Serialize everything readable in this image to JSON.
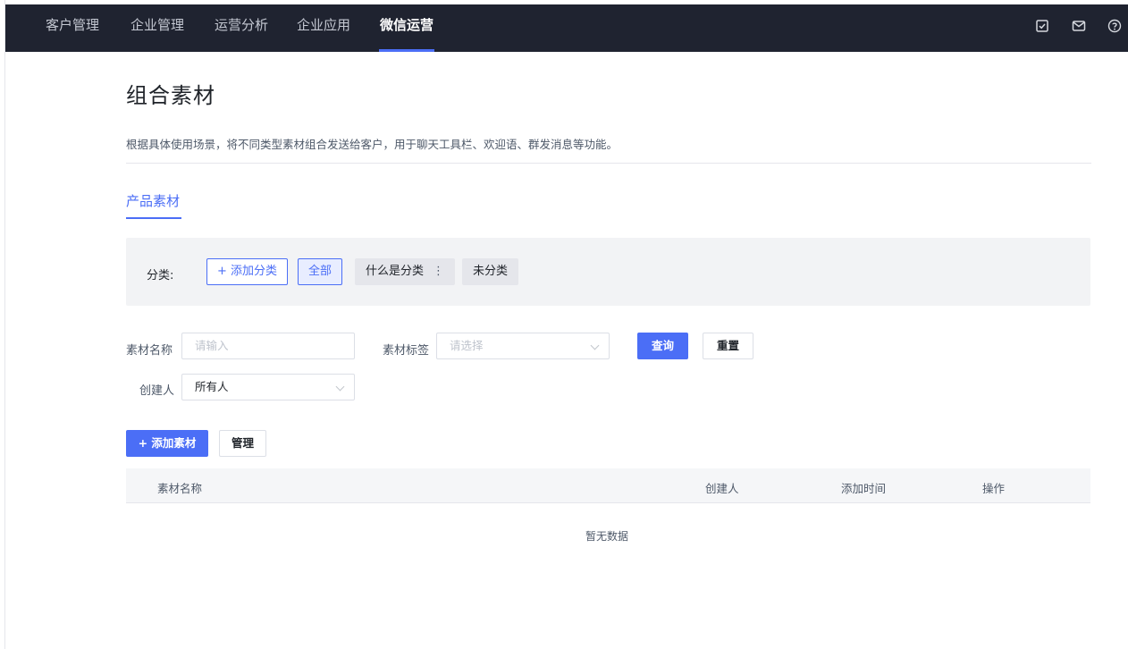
{
  "nav": {
    "items": [
      "客户管理",
      "企业管理",
      "运营分析",
      "企业应用",
      "微信运营"
    ],
    "active_index": 4,
    "icons": [
      "task-check-icon",
      "mail-icon",
      "help-icon"
    ]
  },
  "page": {
    "title": "组合素材",
    "description": "根据具体使用场景，将不同类型素材组合发送给客户，用于聊天工具栏、欢迎语、群发消息等功能。"
  },
  "tabs": [
    "产品素材"
  ],
  "category": {
    "label": "分类:",
    "add_label": "+ 添加分类",
    "items": [
      "全部",
      "什么是分类",
      "未分类"
    ],
    "selected": "全部",
    "more_glyph": "⋮"
  },
  "filters": {
    "name_label": "素材名称",
    "name_placeholder": "请输入",
    "tag_label": "素材标签",
    "tag_placeholder": "请选择",
    "creator_label": "创建人",
    "creator_value": "所有人",
    "query_label": "查询",
    "reset_label": "重置"
  },
  "actions": {
    "add_material_label": "+ 添加素材",
    "manage_label": "管理"
  },
  "table": {
    "columns": [
      "素材名称",
      "创建人",
      "添加时间",
      "操作"
    ],
    "rows": [],
    "empty_text": "暂无数据"
  },
  "colors": {
    "nav_bg": "#1f2330",
    "accent": "#4b6ef6",
    "panel_bg": "#f2f3f5"
  }
}
